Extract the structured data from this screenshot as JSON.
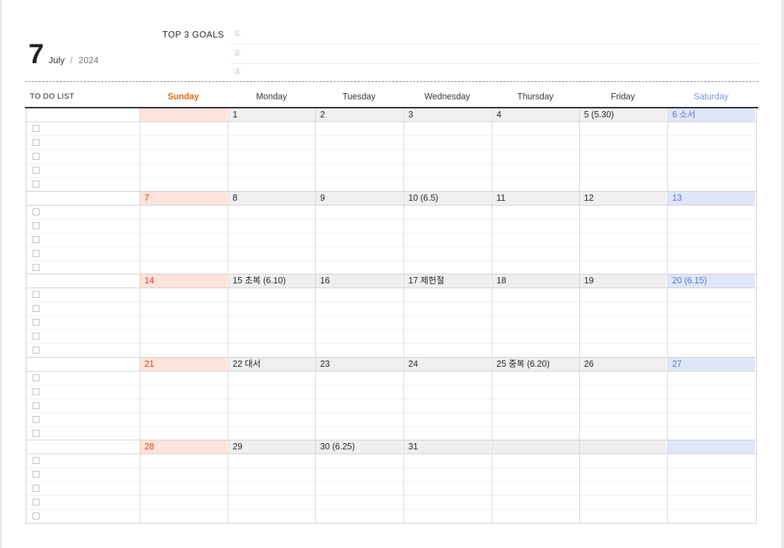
{
  "header": {
    "month_number": "7",
    "month_name": "July",
    "separator": "/",
    "year": "2024"
  },
  "goals": {
    "title": "TOP 3 GOALS",
    "items": [
      "①",
      "②",
      "③"
    ]
  },
  "table": {
    "todo_label": "TO DO LIST",
    "days": [
      "Sunday",
      "Monday",
      "Tuesday",
      "Wednesday",
      "Thursday",
      "Friday",
      "Saturday"
    ],
    "weeks": [
      [
        "",
        "1",
        "2",
        "3",
        "4",
        "5 (5.30)",
        "6 소서"
      ],
      [
        "7",
        "8",
        "9",
        "10 (6.5)",
        "11",
        "12",
        "13"
      ],
      [
        "14",
        "15 초복 (6.10)",
        "16",
        "17 제헌절",
        "18",
        "19",
        "20 (6.15)"
      ],
      [
        "21",
        "22 대서",
        "23",
        "24",
        "25 중복 (6.20)",
        "26",
        "27"
      ],
      [
        "28",
        "29",
        "30 (6.25)",
        "31",
        "",
        "",
        ""
      ]
    ]
  },
  "colors": {
    "sunday_text": "#e06a14",
    "saturday_text": "#7b94da",
    "sunday_cell_bg": "#fde3d9",
    "saturday_cell_bg": "#dfe6f7",
    "weekday_cell_bg": "#efefef"
  }
}
